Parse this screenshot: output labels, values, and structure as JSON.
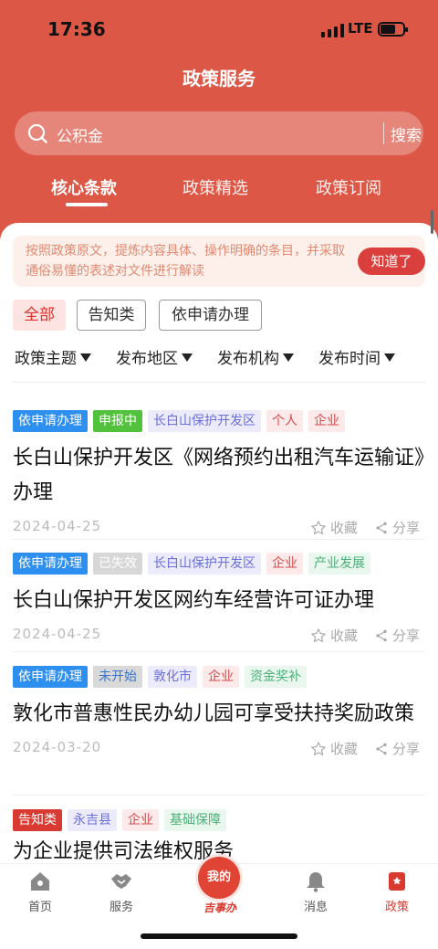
{
  "status_bar": {
    "time": "17:36",
    "network": "LTE"
  },
  "header": {
    "title": "政策服务"
  },
  "search": {
    "value": "公积金",
    "button": "搜索"
  },
  "tabs": [
    {
      "label": "核心条款",
      "active": true
    },
    {
      "label": "政策精选",
      "active": false
    },
    {
      "label": "政策订阅",
      "active": false
    }
  ],
  "notice": {
    "text": "按照政策原文，提炼内容具体、操作明确的条目，并采取通俗易懂的表述对文件进行解读",
    "button": "知道了"
  },
  "filters": {
    "all": "全部",
    "inform": "告知类",
    "apply": "依申请办理"
  },
  "dropdowns": [
    "政策主题",
    "发布地区",
    "发布机构",
    "发布时间"
  ],
  "cards": [
    {
      "tags": [
        "依申请办理",
        "申报中",
        "长白山保护开发区",
        "个人",
        "企业"
      ],
      "title": "长白山保护开发区《网络预约出租汽车运输证》办理",
      "date": "2024-04-25",
      "favorite": "收藏",
      "share": "分享"
    },
    {
      "tags": [
        "依申请办理",
        "已失效",
        "长白山保护开发区",
        "企业",
        "产业发展"
      ],
      "title": "长白山保护开发区网约车经营许可证办理",
      "date": "2024-04-25",
      "favorite": "收藏",
      "share": "分享"
    },
    {
      "tags": [
        "依申请办理",
        "未开始",
        "敦化市",
        "企业",
        "资金奖补"
      ],
      "title": "敦化市普惠性民办幼儿园可享受扶持奖励政策",
      "date": "2024-03-20",
      "favorite": "收藏",
      "share": "分享"
    },
    {
      "tags": [
        "告知类",
        "永吉县",
        "企业",
        "基础保障"
      ],
      "title": "为企业提供司法维权服务"
    }
  ],
  "tabbar": {
    "home": "首页",
    "service": "服务",
    "center_button": "我的",
    "center_label": "吉事办",
    "messages": "消息",
    "policy": "政策"
  },
  "colors": {
    "brand": "#dd5746",
    "accent_red": "#d93a32",
    "tag_blue": "#2d8ff0",
    "tag_green": "#52c23d"
  }
}
